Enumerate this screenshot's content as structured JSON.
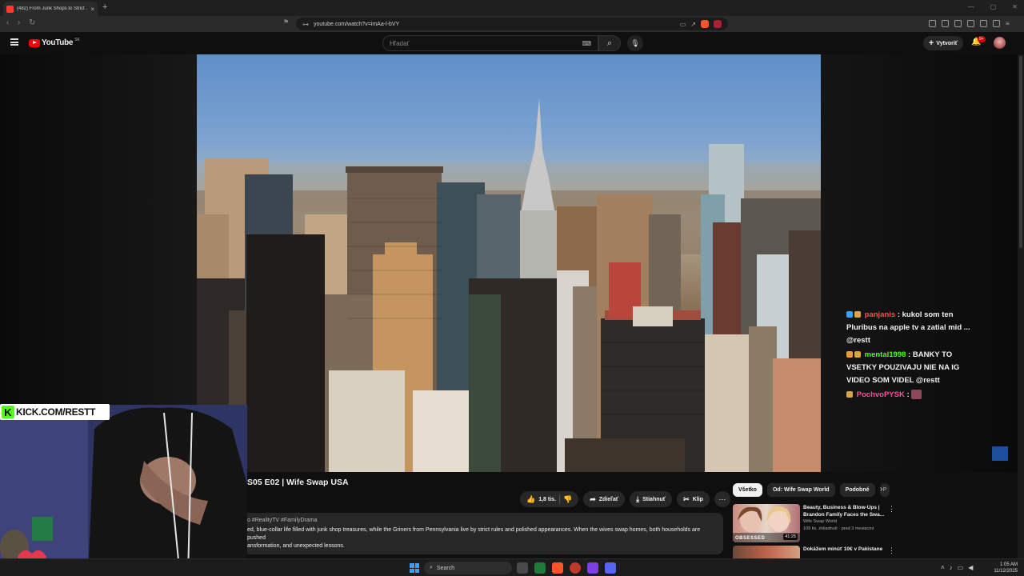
{
  "browser": {
    "tab_title": "(482) From Junk Shops to Strict ...",
    "tab_close": "×",
    "new_tab": "+",
    "url": "youtube.com/watch?v=imAa-l-bVY"
  },
  "header": {
    "logo_text": "YouTube",
    "country": "SK",
    "search_placeholder": "Hľadať",
    "create_label": "Vytvoriť",
    "notifications_badge": "9+"
  },
  "chat": [
    {
      "user": "panjanis",
      "user_color": "#ff4d4d",
      "message": ": kukol som ten Pluribus na apple tv a zatial mid ... @restt"
    },
    {
      "user": "mental1998",
      "user_color": "#53fc18",
      "message": ": BANKY TO VSETKY POUZIVAJU NIE NA IG VIDEO SOM VIDEL @restt"
    },
    {
      "user": "PochvoPYSK",
      "user_color": "#ff4d9e",
      "message": ":"
    }
  ],
  "kick": {
    "letter": "K",
    "text": "KICK.COM/RESTT"
  },
  "video": {
    "title": "S05 E02 | Wife Swap USA",
    "likes": "1,8 tis.",
    "share": "Zdieľať",
    "download": "Stiahnuť",
    "clip": "Klip",
    "more": "⋯",
    "tags": "o #RealityTV #FamilyDrama",
    "description_1": "ed, blue-collar life filled with junk shop treasures, while the Griners from Pennsylvania live by strict rules and polished appearances. When the wives swap homes, both households are pushed",
    "description_2": "ansformation, and unexpected lessons."
  },
  "chips": [
    "Všetko",
    "Od: Wife Swap World",
    "Podobné",
    "P"
  ],
  "recommendations": [
    {
      "title": "Beauty, Business & Blow-Ups | Brandon Family Faces the Swa...",
      "channel": "Wife Swap World",
      "meta": "109 tis. zhliadnutí · pred 3 mesiacmi",
      "duration": "41:25",
      "tag": "OBSESSED"
    },
    {
      "title": "Dokážem minúť 10€ v Pakistane",
      "channel": "",
      "meta": "",
      "duration": "",
      "tag": ""
    }
  ],
  "taskbar": {
    "search_label": "Search",
    "time": "1:05 AM",
    "date": "11/12/2025"
  }
}
